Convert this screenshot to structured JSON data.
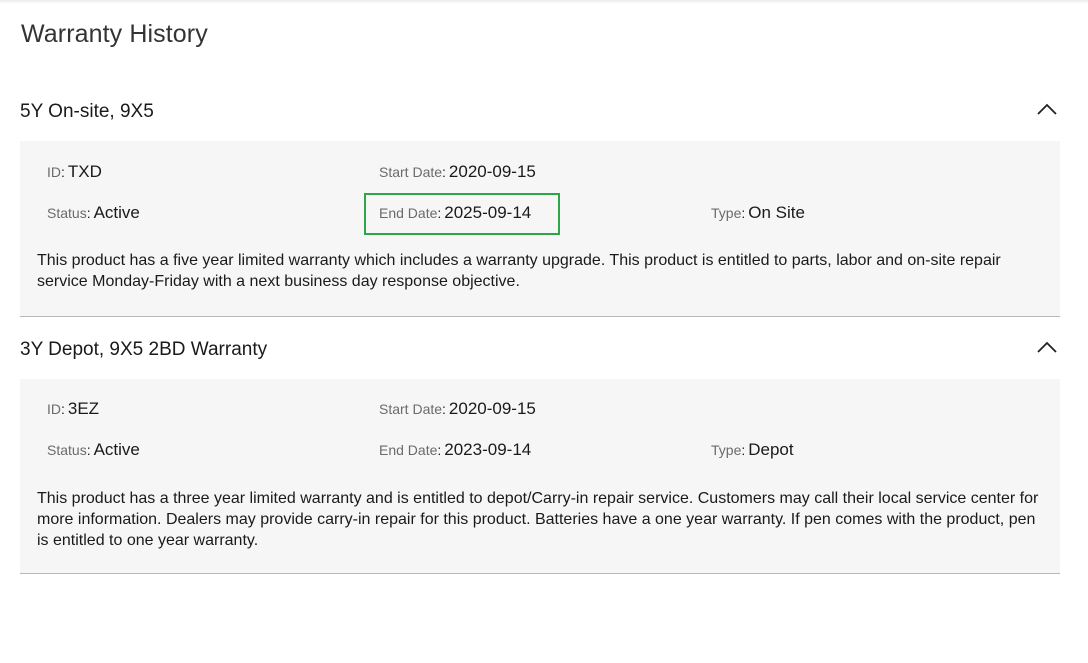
{
  "page": {
    "title": "Warranty History"
  },
  "warranties": [
    {
      "name": "5Y On-site, 9X5",
      "id_label": "ID",
      "id_value": "TXD",
      "start_label": "Start Date",
      "start_value": "2020-09-15",
      "status_label": "Status",
      "status_value": "Active",
      "end_label": "End Date",
      "end_value": "2025-09-14",
      "type_label": "Type",
      "type_value": "On Site",
      "description": "This product has a five year limited warranty which includes a warranty upgrade. This product is entitled to parts, labor and on-site repair service Monday-Friday with a next business day response objective.",
      "expanded": true
    },
    {
      "name": "3Y Depot, 9X5 2BD Warranty",
      "id_label": "ID",
      "id_value": "3EZ",
      "start_label": "Start Date",
      "start_value": "2020-09-15",
      "status_label": "Status",
      "status_value": "Active",
      "end_label": "End Date",
      "end_value": "2023-09-14",
      "type_label": "Type",
      "type_value": "Depot",
      "description": "This product has a three year limited warranty and is entitled to depot/Carry-in repair service. Customers may call their local service center for more information. Dealers may provide carry-in repair for this product. Batteries have a one year warranty. If pen comes with the product, pen is entitled to one year warranty.",
      "expanded": true
    }
  ],
  "colors": {
    "highlight_border": "#2fa54a",
    "panel_background": "#f6f6f6"
  },
  "icons": {
    "collapse": "chevron-up-icon"
  }
}
